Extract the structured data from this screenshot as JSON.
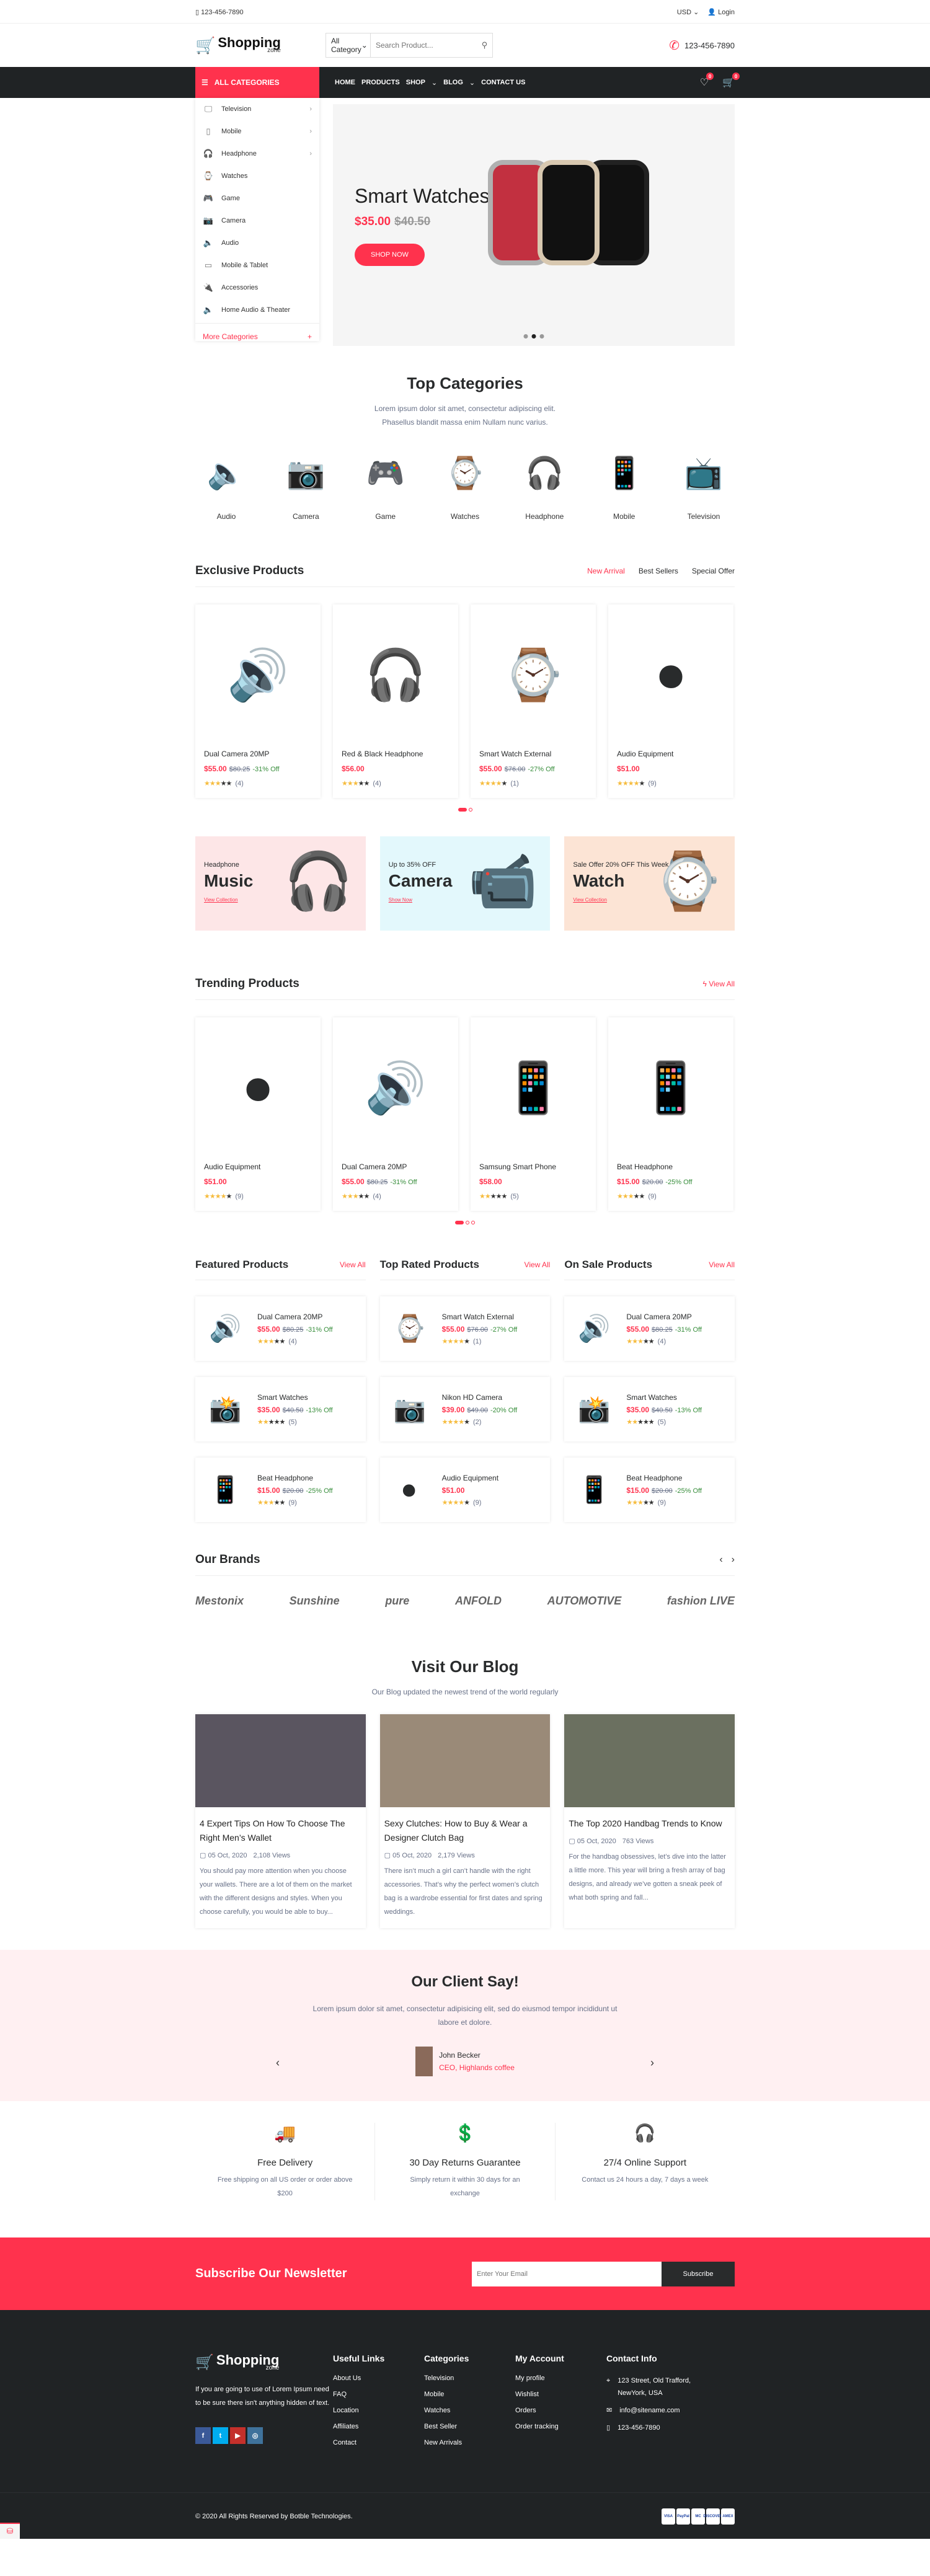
{
  "topbar": {
    "phone": "123-456-7890",
    "currency": "USD",
    "login": "Login"
  },
  "header": {
    "logo_name": "Shopping",
    "logo_sub": "zone",
    "category_select": "All Category",
    "search_placeholder": "Search Product...",
    "phone": "123-456-7890"
  },
  "nav": {
    "all_categories": "ALL CATEGORIES",
    "menu": [
      "HOME",
      "PRODUCTS",
      "SHOP",
      "BLOG",
      "CONTACT US"
    ],
    "wishlist_count": "0",
    "cart_count": "0"
  },
  "sidebar": {
    "items": [
      {
        "label": "Television",
        "icon": "tv-icon",
        "sub": true
      },
      {
        "label": "Mobile",
        "icon": "mobile-icon",
        "sub": true
      },
      {
        "label": "Headphone",
        "icon": "headphone-icon",
        "sub": true
      },
      {
        "label": "Watches",
        "icon": "watch-icon",
        "sub": false
      },
      {
        "label": "Game",
        "icon": "gamepad-icon",
        "sub": false
      },
      {
        "label": "Camera",
        "icon": "camera-icon",
        "sub": false
      },
      {
        "label": "Audio",
        "icon": "speaker-icon",
        "sub": false
      },
      {
        "label": "Mobile & Tablet",
        "icon": "tablet-icon",
        "sub": false
      },
      {
        "label": "Accessories",
        "icon": "plug-icon",
        "sub": false
      },
      {
        "label": "Home Audio & Theater",
        "icon": "speaker-icon",
        "sub": false
      }
    ],
    "more": "More Categories"
  },
  "hero": {
    "title": "Smart Watches",
    "price": "$35.00",
    "old_price": "$40.50",
    "button": "SHOP NOW",
    "slides": 3,
    "active_slide": 2
  },
  "top_categories": {
    "title": "Top Categories",
    "subtitle": "Lorem ipsum dolor sit amet, consectetur adipiscing elit. Phasellus blandit massa enim Nullam nunc varius.",
    "items": [
      {
        "label": "Audio",
        "glyph": "🔈"
      },
      {
        "label": "Camera",
        "glyph": "📷"
      },
      {
        "label": "Game",
        "glyph": "🎮"
      },
      {
        "label": "Watches",
        "glyph": "⌚"
      },
      {
        "label": "Headphone",
        "glyph": "🎧"
      },
      {
        "label": "Mobile",
        "glyph": "📱"
      },
      {
        "label": "Television",
        "glyph": "📺"
      }
    ]
  },
  "exclusive": {
    "title": "Exclusive Products",
    "tabs": [
      "New Arrival",
      "Best Sellers",
      "Special Offer"
    ],
    "active_tab": 0,
    "products": [
      {
        "name": "Dual Camera 20MP",
        "price": "$55.00",
        "old": "$80.25",
        "off": "-31% Off",
        "stars": 3,
        "reviews": "(4)",
        "glyph": "🔊"
      },
      {
        "name": "Red & Black Headphone",
        "price": "$56.00",
        "old": "",
        "off": "",
        "stars": 3,
        "reviews": "(4)",
        "glyph": "🎧"
      },
      {
        "name": "Smart Watch External",
        "price": "$55.00",
        "old": "$76.00",
        "off": "-27% Off",
        "stars": 4,
        "reviews": "(1)",
        "glyph": "⌚"
      },
      {
        "name": "Audio Equipment",
        "price": "$51.00",
        "old": "",
        "off": "",
        "stars": 4,
        "reviews": "(9)",
        "glyph": "⏺"
      }
    ]
  },
  "banners": [
    {
      "small": "Headphone",
      "big": "Music",
      "link": "View Collection",
      "bg": "#fde6e7",
      "glyph": "🎧"
    },
    {
      "small": "Up to 35% OFF",
      "big": "Camera",
      "link": "Show Now",
      "bg": "#e3f8fc",
      "glyph": "📹"
    },
    {
      "small": "Sale Offer 20% OFF This Week",
      "big": "Watch",
      "link": "View Collection",
      "bg": "#fce4d5",
      "glyph": "⌚"
    }
  ],
  "trending": {
    "title": "Trending Products",
    "view_all": "View All",
    "products": [
      {
        "name": "Audio Equipment",
        "price": "$51.00",
        "old": "",
        "off": "",
        "stars": 4,
        "reviews": "(9)",
        "glyph": "⏺"
      },
      {
        "name": "Dual Camera 20MP",
        "price": "$55.00",
        "old": "$80.25",
        "off": "-31% Off",
        "stars": 3,
        "reviews": "(4)",
        "glyph": "🔊"
      },
      {
        "name": "Samsung Smart Phone",
        "price": "$58.00",
        "old": "",
        "off": "",
        "stars": 2,
        "reviews": "(5)",
        "glyph": "📱"
      },
      {
        "name": "Beat Headphone",
        "price": "$15.00",
        "old": "$20.00",
        "off": "-25% Off",
        "stars": 3,
        "reviews": "(9)",
        "glyph": "📱"
      }
    ]
  },
  "lists": [
    {
      "title": "Featured Products",
      "view_all": "View All",
      "items": [
        {
          "name": "Dual Camera 20MP",
          "price": "$55.00",
          "old": "$80.25",
          "off": "-31% Off",
          "stars": 3,
          "reviews": "(4)",
          "glyph": "🔊"
        },
        {
          "name": "Smart Watches",
          "price": "$35.00",
          "old": "$40.50",
          "off": "-13% Off",
          "stars": 2,
          "reviews": "(5)",
          "glyph": "📸"
        },
        {
          "name": "Beat Headphone",
          "price": "$15.00",
          "old": "$20.00",
          "off": "-25% Off",
          "stars": 3,
          "reviews": "(9)",
          "glyph": "📱"
        }
      ]
    },
    {
      "title": "Top Rated Products",
      "view_all": "View All",
      "items": [
        {
          "name": "Smart Watch External",
          "price": "$55.00",
          "old": "$76.00",
          "off": "-27% Off",
          "stars": 4,
          "reviews": "(1)",
          "glyph": "⌚"
        },
        {
          "name": "Nikon HD Camera",
          "price": "$39.00",
          "old": "$49.00",
          "off": "-20% Off",
          "stars": 4,
          "reviews": "(2)",
          "glyph": "📷"
        },
        {
          "name": "Audio Equipment",
          "price": "$51.00",
          "old": "",
          "off": "",
          "stars": 4,
          "reviews": "(9)",
          "glyph": "⏺"
        }
      ]
    },
    {
      "title": "On Sale Products",
      "view_all": "View All",
      "items": [
        {
          "name": "Dual Camera 20MP",
          "price": "$55.00",
          "old": "$80.25",
          "off": "-31% Off",
          "stars": 3,
          "reviews": "(4)",
          "glyph": "🔊"
        },
        {
          "name": "Smart Watches",
          "price": "$35.00",
          "old": "$40.50",
          "off": "-13% Off",
          "stars": 2,
          "reviews": "(5)",
          "glyph": "📸"
        },
        {
          "name": "Beat Headphone",
          "price": "$15.00",
          "old": "$20.00",
          "off": "-25% Off",
          "stars": 3,
          "reviews": "(9)",
          "glyph": "📱"
        }
      ]
    }
  ],
  "brands": {
    "title": "Our Brands",
    "items": [
      "Mestonix",
      "Sunshine",
      "pure",
      "ANFOLD",
      "AUTOMOTIVE",
      "fashion LIVE"
    ]
  },
  "blog": {
    "title": "Visit Our Blog",
    "subtitle": "Our Blog updated the newest trend of the world regularly",
    "posts": [
      {
        "title": "4 Expert Tips On How To Choose The Right Men’s Wallet",
        "date": "05 Oct, 2020",
        "views": "2,108 Views",
        "excerpt": "You should pay more attention when you choose your wallets. There are a lot of them on the market with the different designs and styles. When you choose carefully, you would be able to buy...",
        "bg": "#5a5560"
      },
      {
        "title": "Sexy Clutches: How to Buy & Wear a Designer Clutch Bag",
        "date": "05 Oct, 2020",
        "views": "2,179 Views",
        "excerpt": "There isn’t much a girl can’t handle with the right accessories. That’s why the perfect women’s clutch bag is a wardrobe essential for first dates and spring weddings.",
        "bg": "#9a8a78"
      },
      {
        "title": "The Top 2020 Handbag Trends to Know",
        "date": "05 Oct, 2020",
        "views": "763 Views",
        "excerpt": "For the handbag obsessives, let’s dive into the latter a little more. This year will bring a fresh array of bag designs, and already we’ve gotten a sneak peek of what both spring and fall...",
        "bg": "#6b7060"
      }
    ]
  },
  "testimonial": {
    "title": "Our Client Say!",
    "text": "Lorem ipsum dolor sit amet, consectetur adipisicing elit, sed do eiusmod tempor incididunt ut labore et dolore.",
    "name": "John Becker",
    "role": "CEO, Highlands coffee"
  },
  "features": [
    {
      "title": "Free Delivery",
      "text": "Free shipping on all US order or order above $200",
      "icon": "🚚"
    },
    {
      "title": "30 Day Returns Guarantee",
      "text": "Simply return it within 30 days for an exchange",
      "icon": "💲"
    },
    {
      "title": "27/4 Online Support",
      "text": "Contact us 24 hours a day, 7 days a week",
      "icon": "🎧"
    }
  ],
  "newsletter": {
    "title": "Subscribe Our Newsletter",
    "placeholder": "Enter Your Email",
    "button": "Subscribe"
  },
  "footer": {
    "about": "If you are going to use of Lorem Ipsum need to be sure there isn't anything hidden of text.",
    "social": [
      "f",
      "t",
      "▶",
      "◎"
    ],
    "useful": {
      "title": "Useful Links",
      "items": [
        "About Us",
        "FAQ",
        "Location",
        "Affiliates",
        "Contact"
      ]
    },
    "categories": {
      "title": "Categories",
      "items": [
        "Television",
        "Mobile",
        "Watches",
        "Best Seller",
        "New Arrivals"
      ]
    },
    "account": {
      "title": "My Account",
      "items": [
        "My profile",
        "Wishlist",
        "Orders",
        "Order tracking"
      ]
    },
    "contact": {
      "title": "Contact Info",
      "address": "123 Street, Old Trafford, NewYork, USA",
      "email": "info@sitename.com",
      "phone": "123-456-7890"
    },
    "copyright": "© 2020 All Rights Reserved by Botble Technologies.",
    "payments": [
      "VISA",
      "PayPal",
      "MC",
      "DISCOVER",
      "AMEX"
    ]
  },
  "colors": {
    "accent": "#ff324d",
    "dark": "#202325"
  }
}
